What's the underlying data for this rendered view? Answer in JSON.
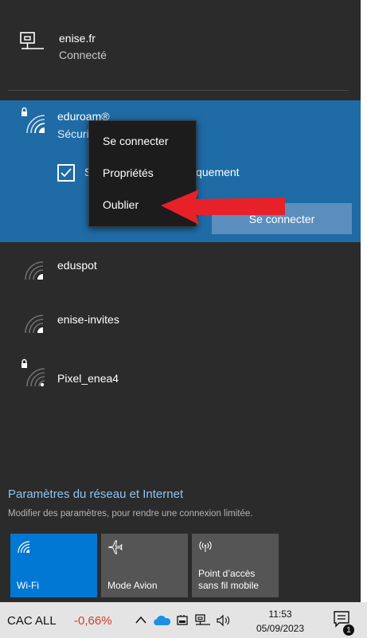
{
  "connected_network": {
    "name": "enise.fr",
    "status": "Connecté",
    "icon": "ethernet-icon"
  },
  "selected_network": {
    "name": "eduroam®",
    "status": "Sécurisé",
    "auto_connect_label": "Se connecter automatiquement",
    "auto_connect_checked": true,
    "connect_button": "Se connecter",
    "icon": "wifi-secured-icon"
  },
  "context_menu": {
    "items": [
      "Se connecter",
      "Propriétés",
      "Oublier"
    ]
  },
  "networks": [
    {
      "name": "eduspot",
      "secured": false
    },
    {
      "name": "enise-invites",
      "secured": false
    },
    {
      "name": "Pixel_enea4",
      "secured": true
    }
  ],
  "settings": {
    "link": "Paramètres du réseau et Internet",
    "subtitle": "Modifier des paramètres, pour rendre une connexion limitée."
  },
  "quick_actions": [
    {
      "label": "Wi-Fi",
      "active": true,
      "icon": "wifi-icon"
    },
    {
      "label": "Mode Avion",
      "active": false,
      "icon": "airplane-icon"
    },
    {
      "label": "Point d'accès sans fil mobile",
      "label_line1": "Point d’accès",
      "label_line2": "sans fil mobile",
      "active": false,
      "icon": "hotspot-icon"
    }
  ],
  "taskbar": {
    "ticker_name": "CAC ALL",
    "ticker_change": "-0,66%",
    "time": "11:53",
    "date": "05/09/2023",
    "notification_count": "1"
  },
  "colors": {
    "flyout_bg": "#2b2b2b",
    "selected_bg": "#1e6ba6",
    "accent": "#0078d4",
    "link": "#8ec4f2",
    "arrow": "#e8202a",
    "negative": "#d93b2d"
  }
}
